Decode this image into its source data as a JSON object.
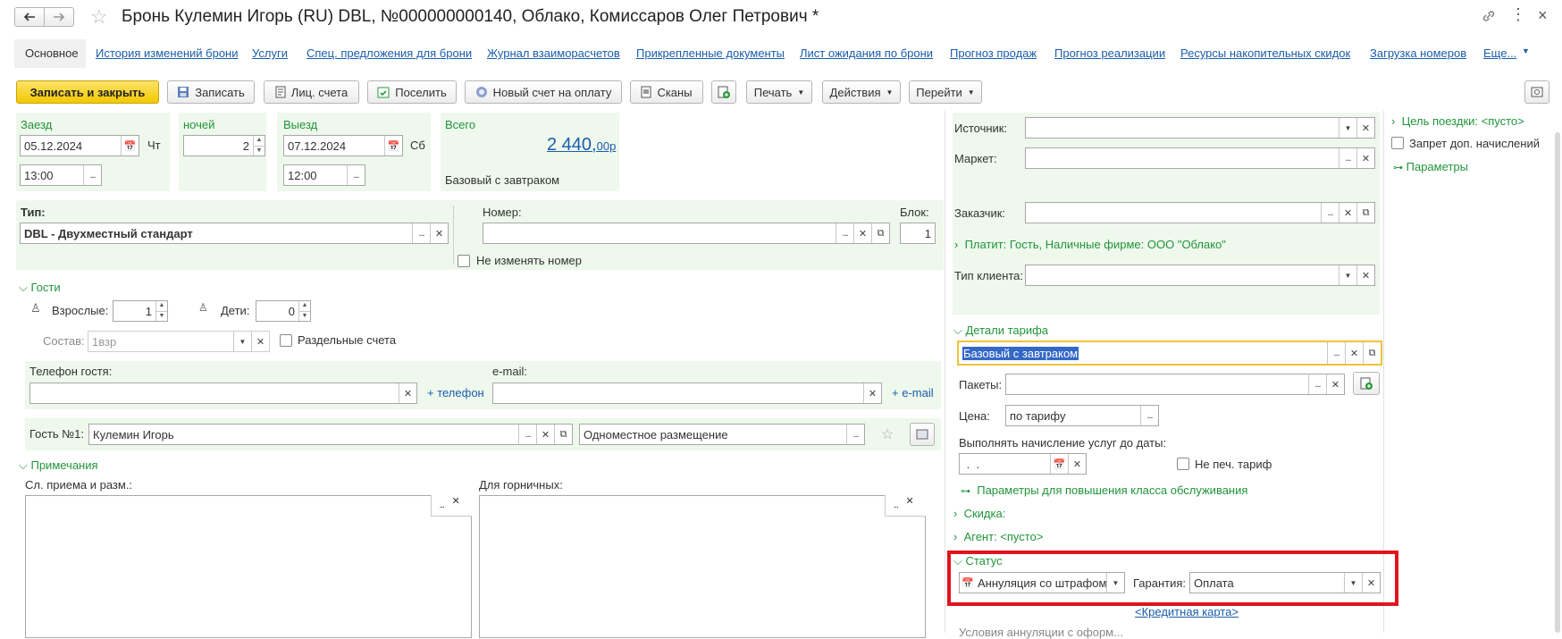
{
  "window": {
    "title": "Бронь Кулемин Игорь (RU) DBL, №000000000140, Облако, Комиссаров Олег Петрович *"
  },
  "tabs": [
    "Основное",
    "История изменений брони",
    "Услуги",
    "Спец. предложения для брони",
    "Журнал взаиморасчетов",
    "Прикрепленные документы",
    "Лист ожидания по брони",
    "Прогноз продаж",
    "Прогноз реализации",
    "Ресурсы накопительных скидок",
    "Загрузка номеров",
    "Еще..."
  ],
  "toolbar": {
    "save_close": "Записать и закрыть",
    "save": "Записать",
    "accounts": "Лиц. счета",
    "settle": "Поселить",
    "new_invoice": "Новый счет на оплату",
    "scans": "Сканы",
    "print": "Печать",
    "actions": "Действия",
    "goto": "Перейти"
  },
  "stay": {
    "checkin_label": "Заезд",
    "checkin_date": "05.12.2024",
    "checkin_day": "Чт",
    "checkin_time": "13:00",
    "nights_label": "ночей",
    "nights": "2",
    "checkout_label": "Выезд",
    "checkout_date": "07.12.2024",
    "checkout_day": "Сб",
    "checkout_time": "12:00",
    "total_label": "Всего",
    "total_main": "2 440,",
    "total_cents": "00р",
    "rate_name": "Базовый с завтраком"
  },
  "room": {
    "type_label": "Тип:",
    "type_value": "DBL - Двухместный стандарт",
    "number_label": "Номер:",
    "number_value": "",
    "block_label": "Блок:",
    "block_value": "1",
    "keep_number": "Не изменять номер"
  },
  "guests": {
    "header": "Гости",
    "adults_label": "Взрослые:",
    "adults": "1",
    "children_label": "Дети:",
    "children": "0",
    "composition_label": "Состав:",
    "composition_value": "1взр",
    "split_accounts": "Раздельные счета",
    "phone_label": "Телефон гостя:",
    "add_phone": "+ телефон",
    "email_label": "e-mail:",
    "add_email": "+ e-mail",
    "guest1_label": "Гость №1:",
    "guest1_name": "Кулемин Игорь",
    "guest1_accommodation": "Одноместное размещение"
  },
  "notes": {
    "header": "Примечания",
    "reception_label": "Сл. приема и разм.:",
    "maids_label": "Для горничных:"
  },
  "right": {
    "source_label": "Источник:",
    "market_label": "Маркет:",
    "customer_label": "Заказчик:",
    "payer": "Платит: Гость, Наличные фирме: ООО \"Облако\"",
    "client_type_label": "Тип клиента:",
    "tariff_header": "Детали тарифа",
    "tariff_value": "Базовый с завтраком",
    "packages_label": "Пакеты:",
    "price_label": "Цена:",
    "price_value": "по тарифу",
    "charge_until_label": "Выполнять начисление услуг до даты:",
    "charge_until_value": " .  .",
    "no_print_tariff": "Не печ. тариф",
    "upgrade_params": "Параметры для повышения класса обслуживания",
    "discount": "Скидка:",
    "agent": "Агент: <пусто>",
    "status_header": "Статус",
    "status_value": "Аннуляция со штрафом",
    "guarantee_label": "Гарантия:",
    "guarantee_value": "Оплата",
    "credit_card": "<Кредитная карта>",
    "cut_text": "Условия аннуляции с оформ..."
  },
  "side": {
    "trip_purpose": "Цель поездки: <пусто>",
    "extra_charges_ban": "Запрет доп. начислений",
    "params": "Параметры"
  },
  "colors": {
    "accent_green": "#21943a",
    "link": "#1a5dab",
    "highlight_red": "#e0141e",
    "primary_yellow": "#f7d52a"
  }
}
